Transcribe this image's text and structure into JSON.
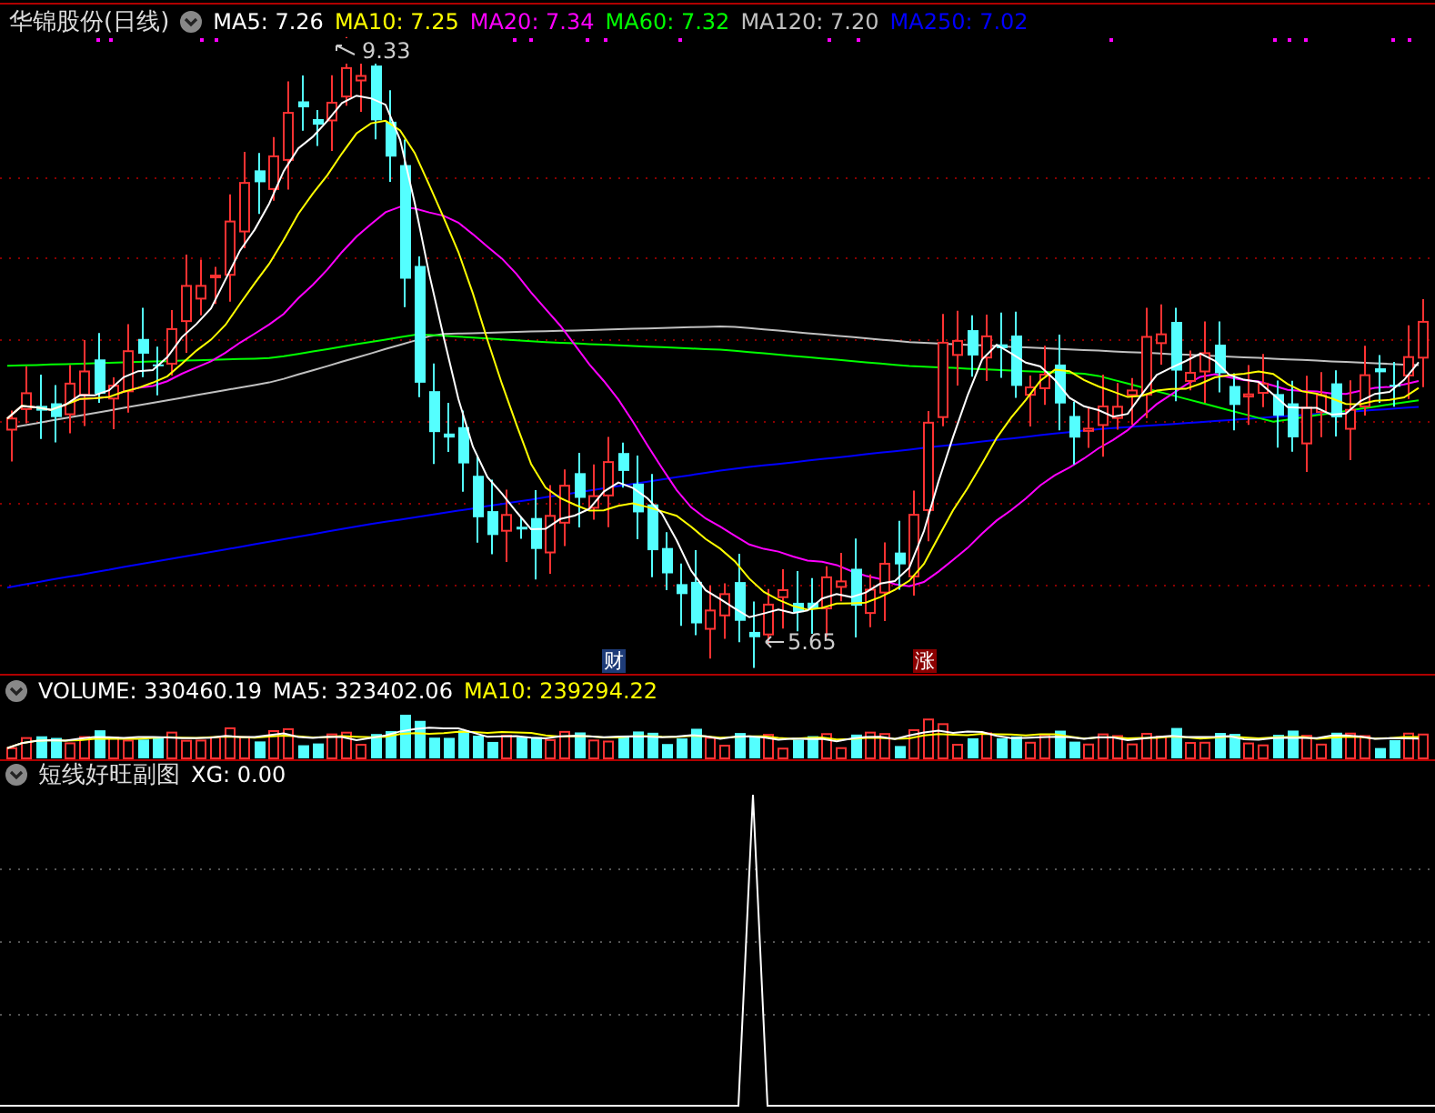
{
  "main_panel": {
    "title": "华锦股份(日线)",
    "indicators": [
      {
        "label": "MA5: 7.26",
        "color": "#ffffff"
      },
      {
        "label": "MA10: 7.25",
        "color": "#ffff00"
      },
      {
        "label": "MA20: 7.34",
        "color": "#ff00ff"
      },
      {
        "label": "MA60: 7.32",
        "color": "#00ff00"
      },
      {
        "label": "MA120: 7.20",
        "color": "#c0c0c0"
      },
      {
        "label": "MA250: 7.02",
        "color": "#0000ff"
      }
    ],
    "high_label": "9.33",
    "low_label": "5.65",
    "markers": [
      {
        "text": "财",
        "color": "#1e3c78"
      },
      {
        "text": "涨",
        "color": "#8b0000"
      }
    ]
  },
  "volume_panel": {
    "indicators": [
      {
        "label": "VOLUME: 330460.19",
        "color": "#ffffff"
      },
      {
        "label": "MA5: 323402.06",
        "color": "#ffffff"
      },
      {
        "label": "MA10: 239294.22",
        "color": "#ffff00"
      }
    ]
  },
  "indicator_panel": {
    "title": "短线好旺副图",
    "indicators": [
      {
        "label": "XG: 0.00",
        "color": "#ffffff"
      }
    ]
  }
}
